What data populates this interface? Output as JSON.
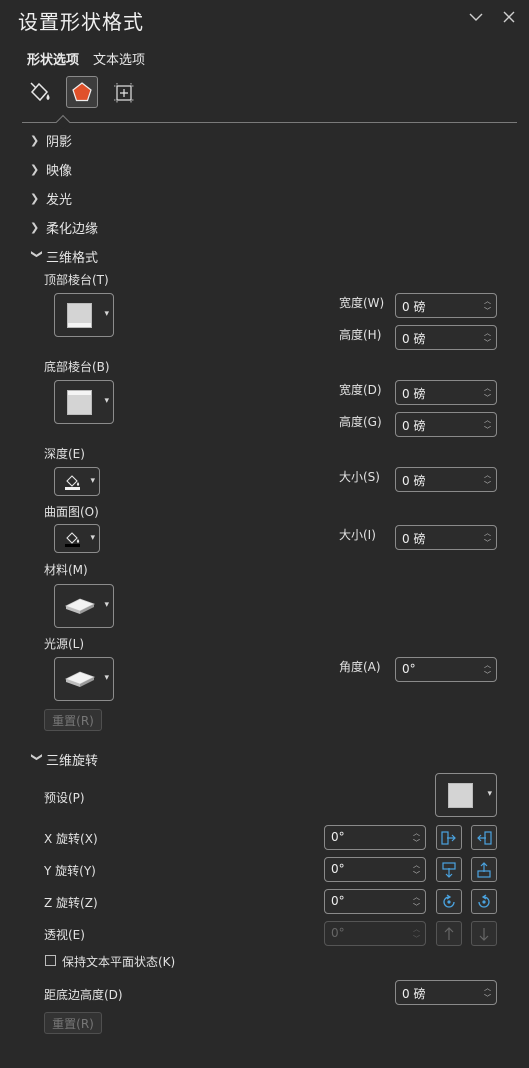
{
  "header": {
    "title": "设置形状格式"
  },
  "tabs": [
    {
      "label": "形状选项",
      "active": true
    },
    {
      "label": "文本选项",
      "active": false
    }
  ],
  "category_icons": [
    "paint-bucket-icon",
    "pentagon-effects-icon",
    "size-properties-icon"
  ],
  "sections": {
    "shadow": "阴影",
    "reflection": "映像",
    "glow": "发光",
    "soft_edges": "柔化边缘",
    "format_3d": "三维格式",
    "rotation_3d": "三维旋转"
  },
  "format3d": {
    "top_bevel_label": "顶部棱台(T)",
    "bottom_bevel_label": "底部棱台(B)",
    "depth_label": "深度(E)",
    "contour_label": "曲面图(O)",
    "material_label": "材料(M)",
    "lighting_label": "光源(L)",
    "top_width_label": "宽度(W)",
    "top_width_value": "0 磅",
    "top_height_label": "高度(H)",
    "top_height_value": "0 磅",
    "bottom_width_label": "宽度(D)",
    "bottom_width_value": "0 磅",
    "bottom_height_label": "高度(G)",
    "bottom_height_value": "0 磅",
    "depth_size_label": "大小(S)",
    "depth_size_value": "0 磅",
    "contour_size_label": "大小(I)",
    "contour_size_value": "0 磅",
    "angle_label": "角度(A)",
    "angle_value": "0°",
    "reset_label": "重置(R)"
  },
  "rotation3d": {
    "preset_label": "预设(P)",
    "x_label": "X 旋转(X)",
    "x_value": "0°",
    "y_label": "Y 旋转(Y)",
    "y_value": "0°",
    "z_label": "Z 旋转(Z)",
    "z_value": "0°",
    "perspective_label": "透视(E)",
    "perspective_value": "0°",
    "keep_text_flat_label": "保持文本平面状态(K)",
    "keep_text_flat_checked": false,
    "distance_label": "距底边高度(D)",
    "distance_value": "0 磅",
    "reset_label": "重置(R)"
  },
  "colors": {
    "background": "#292929",
    "accent_icon": "#e0512a",
    "rotate_icon": "#4aa3e0"
  }
}
